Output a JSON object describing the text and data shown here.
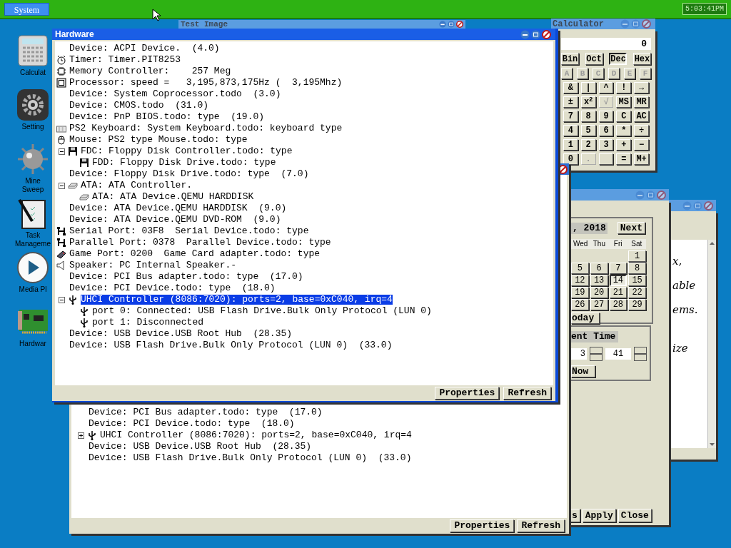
{
  "taskbar": {
    "menu_button": "System",
    "clock": "5:03:41PM"
  },
  "desktop_icons": [
    {
      "label": "Calculat",
      "kind": "calculator"
    },
    {
      "label": "Setting",
      "kind": "settings"
    },
    {
      "label": "Mine Sweep",
      "kind": "mine"
    },
    {
      "label": "Task Manageme",
      "kind": "tasks"
    },
    {
      "label": "Media Pl",
      "kind": "media"
    },
    {
      "label": "Hardwar",
      "kind": "hardware"
    }
  ],
  "test_image_window": {
    "title": "Test Image"
  },
  "calculator": {
    "title": "Calculator",
    "display": "0",
    "modes": [
      {
        "label": "Bin",
        "selected": false
      },
      {
        "label": "Oct",
        "selected": false
      },
      {
        "label": "Dec",
        "selected": true
      },
      {
        "label": "Hex",
        "selected": false
      }
    ],
    "hex_digits": [
      {
        "label": "A",
        "disabled": true
      },
      {
        "label": "B",
        "disabled": true
      },
      {
        "label": "C",
        "disabled": true
      },
      {
        "label": "D",
        "disabled": true
      },
      {
        "label": "E",
        "disabled": true
      },
      {
        "label": "F",
        "disabled": true
      }
    ],
    "keys": [
      {
        "label": "&",
        "disabled": false
      },
      {
        "label": "|",
        "disabled": false
      },
      {
        "label": "^",
        "disabled": false
      },
      {
        "label": "!",
        "disabled": false
      },
      {
        "label": "→",
        "disabled": false
      },
      {
        "label": "±",
        "disabled": false
      },
      {
        "label": "x$^{2}$",
        "disabled": false
      },
      {
        "label": "√",
        "disabled": true
      },
      {
        "label": "MS",
        "disabled": false
      },
      {
        "label": "MR",
        "disabled": false
      },
      {
        "label": "7",
        "disabled": false
      },
      {
        "label": "8",
        "disabled": false
      },
      {
        "label": "9",
        "disabled": false
      },
      {
        "label": "C",
        "disabled": false
      },
      {
        "label": "AC",
        "disabled": false
      },
      {
        "label": "4",
        "disabled": false
      },
      {
        "label": "5",
        "disabled": false
      },
      {
        "label": "6",
        "disabled": false
      },
      {
        "label": "*",
        "disabled": false
      },
      {
        "label": "÷",
        "disabled": false
      },
      {
        "label": "1",
        "disabled": false
      },
      {
        "label": "2",
        "disabled": false
      },
      {
        "label": "3",
        "disabled": false
      },
      {
        "label": "+",
        "disabled": false
      },
      {
        "label": "−",
        "disabled": false
      },
      {
        "label": "0",
        "disabled": false
      },
      {
        "label": ".",
        "disabled": true
      },
      {
        "disabled": false
      },
      {
        "label": "=",
        "disabled": false
      },
      {
        "label": "M+",
        "disabled": false
      }
    ]
  },
  "text_window": {
    "lines": [
      "x,",
      "able",
      "ems.",
      "ize"
    ]
  },
  "calendar": {
    "month_label": ", 2018",
    "next_button": "Next",
    "weekdays": [
      "Wed",
      "Thu",
      "Fri",
      "Sat"
    ],
    "weeks": [
      [
        {
          "kind": "empty"
        },
        {
          "kind": "empty"
        },
        {
          "kind": "empty"
        },
        {
          "kind": "day",
          "label": "1",
          "selected": false
        }
      ],
      [
        {
          "kind": "day",
          "label": "5",
          "selected": false
        },
        {
          "kind": "day",
          "label": "6",
          "selected": false
        },
        {
          "kind": "day",
          "label": "7",
          "selected": false
        },
        {
          "kind": "day",
          "label": "8",
          "selected": false
        }
      ],
      [
        {
          "kind": "day",
          "label": "12",
          "selected": false
        },
        {
          "kind": "day",
          "label": "13",
          "selected": false
        },
        {
          "kind": "day",
          "label": "14",
          "selected": true
        },
        {
          "kind": "day",
          "label": "15",
          "selected": false
        }
      ],
      [
        {
          "kind": "day",
          "label": "19",
          "selected": false
        },
        {
          "kind": "day",
          "label": "20",
          "selected": false
        },
        {
          "kind": "day",
          "label": "21",
          "selected": false
        },
        {
          "kind": "day",
          "label": "22",
          "selected": false
        }
      ],
      [
        {
          "kind": "day",
          "label": "26",
          "selected": false
        },
        {
          "kind": "day",
          "label": "27",
          "selected": false
        },
        {
          "kind": "day",
          "label": "28",
          "selected": false
        },
        {
          "kind": "day",
          "label": "29",
          "selected": false
        }
      ]
    ],
    "today_button": "oday",
    "time_label": "ent Time",
    "hour": "3",
    "minute": "41",
    "now_button": "Now",
    "buttons": [
      "s",
      "Apply",
      "Close"
    ]
  },
  "hardware_back": {
    "items": [
      {
        "text": "Device: PCI Bus adapter.todo: type  (17.0)"
      },
      {
        "text": "Device: PCI Device.todo: type  (18.0)"
      },
      {
        "text": "UHCI Controller (8086:7020): ports=2, base=0xC040, irq=4",
        "kind": "usb",
        "expanded": false
      },
      {
        "text": "Device: USB Device.USB Root Hub  (28.35)"
      },
      {
        "text": "Device: USB Flash Drive.Bulk Only Protocol (LUN 0)  (33.0)"
      }
    ],
    "buttons": [
      "Properties",
      "Refresh"
    ]
  },
  "hardware": {
    "title": "Hardware",
    "items": [
      {
        "text": "Device: ACPI Device.  (4.0)",
        "selected": false
      },
      {
        "text": "Timer: Timer.PIT8253",
        "kind": "clock",
        "selected": false
      },
      {
        "text": "Memory Controller:    257 Meg",
        "kind": "chip",
        "selected": false
      },
      {
        "text": "Processor: speed =   3,195,873,175Hz (  3,195Mhz)",
        "kind": "cpu",
        "selected": false
      },
      {
        "text": "Device: System Coprocessor.todo  (3.0)",
        "selected": false
      },
      {
        "text": "Device: CMOS.todo  (31.0)",
        "selected": false
      },
      {
        "text": "Device: PnP BIOS.todo: type  (19.0)",
        "selected": false
      },
      {
        "text": "PS2 Keyboard: System Keyboard.todo: keyboard type",
        "kind": "keyboard",
        "selected": false
      },
      {
        "text": "Mouse: PS2 type Mouse.todo: type",
        "kind": "mouse",
        "selected": false
      },
      {
        "text": "FDC: Floppy Disk Controller.todo: type",
        "kind": "floppy",
        "selected": false,
        "expanded": true,
        "children": [
          {
            "text": "FDD: Floppy Disk Drive.todo: type",
            "kind": "floppy",
            "selected": false
          }
        ]
      },
      {
        "text": "Device: Floppy Disk Drive.todo: type  (7.0)",
        "selected": false
      },
      {
        "text": "ATA: ATA Controller.",
        "kind": "disk",
        "selected": false,
        "expanded": true,
        "children": [
          {
            "text": "ATA: ATA Device.QEMU HARDDISK",
            "kind": "disk",
            "selected": false
          }
        ]
      },
      {
        "text": "Device: ATA Device.QEMU HARDDISK  (9.0)",
        "selected": false
      },
      {
        "text": "Device: ATA Device.QEMU DVD-ROM  (9.0)",
        "selected": false
      },
      {
        "text": "Serial Port: 03F8  Serial Device.todo: type",
        "kind": "port",
        "selected": false
      },
      {
        "text": "Parallel Port: 0378  Parallel Device.todo: type",
        "kind": "port",
        "selected": false
      },
      {
        "text": "Game Port: 0200  Game Card adapter.todo: type",
        "kind": "gamepad",
        "selected": false
      },
      {
        "text": "Speaker: PC Internal Speaker.-",
        "kind": "speaker",
        "selected": false
      },
      {
        "text": "Device: PCI Bus adapter.todo: type  (17.0)",
        "selected": false
      },
      {
        "text": "Device: PCI Device.todo: type  (18.0)",
        "selected": false
      },
      {
        "text": "UHCI Controller (8086:7020): ports=2, base=0xC040, irq=4",
        "kind": "usb",
        "selected": true,
        "expanded": true,
        "children": [
          {
            "text": "port 0: Connected: USB Flash Drive.Bulk Only Protocol (LUN 0)",
            "kind": "usb",
            "selected": false
          },
          {
            "text": "port 1: Disconnected",
            "kind": "usb",
            "selected": false
          }
        ]
      },
      {
        "text": "Device: USB Device.USB Root Hub  (28.35)",
        "selected": false
      },
      {
        "text": "Device: USB Flash Drive.Bulk Only Protocol (LUN 0)  (33.0)",
        "selected": false
      }
    ],
    "buttons": [
      "Properties",
      "Refresh"
    ]
  }
}
